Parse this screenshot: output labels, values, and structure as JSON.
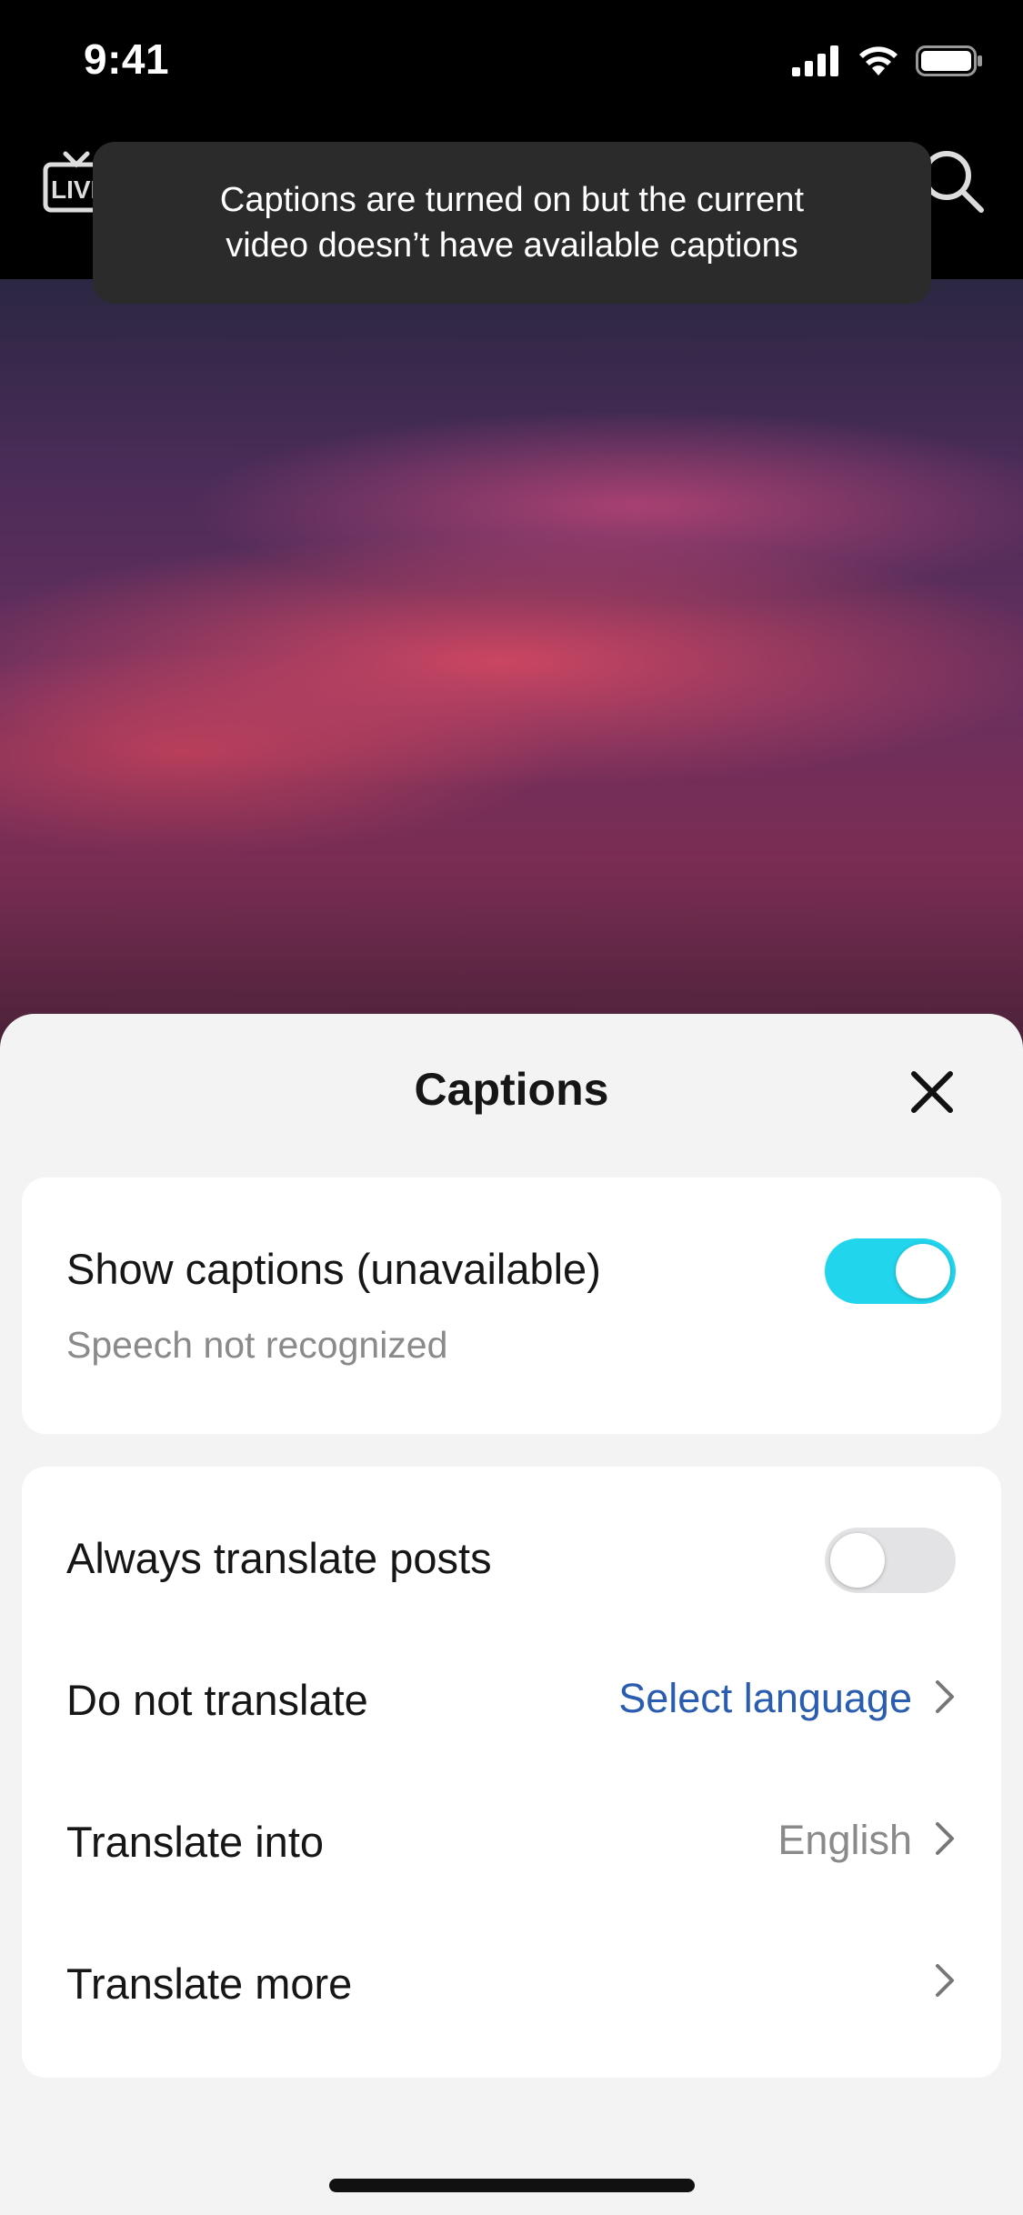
{
  "status_bar": {
    "time": "9:41",
    "icons": [
      "cellular-signal-icon",
      "wifi-icon",
      "battery-icon"
    ]
  },
  "top_nav": {
    "live_icon_text": "LIVE",
    "icons": [
      "live-tv-icon",
      "search-icon"
    ]
  },
  "toast": {
    "line1": "Captions are turned on but the current",
    "line2": "video doesn’t have available captions"
  },
  "sheet": {
    "title": "Captions",
    "close_icon": "close-icon",
    "show_captions": {
      "label": "Show captions (unavailable)",
      "sublabel": "Speech not recognized",
      "enabled": true
    },
    "always_translate": {
      "label": "Always translate posts",
      "enabled": false
    },
    "do_not_translate": {
      "label": "Do not translate",
      "value": "Select language"
    },
    "translate_into": {
      "label": "Translate into",
      "value": "English"
    },
    "translate_more": {
      "label": "Translate more"
    }
  },
  "colors": {
    "toggle_on": "#20d5ec",
    "toggle_off": "#e3e3e5",
    "link_blue": "#2a5db0",
    "secondary_text": "#8a8a8a"
  }
}
